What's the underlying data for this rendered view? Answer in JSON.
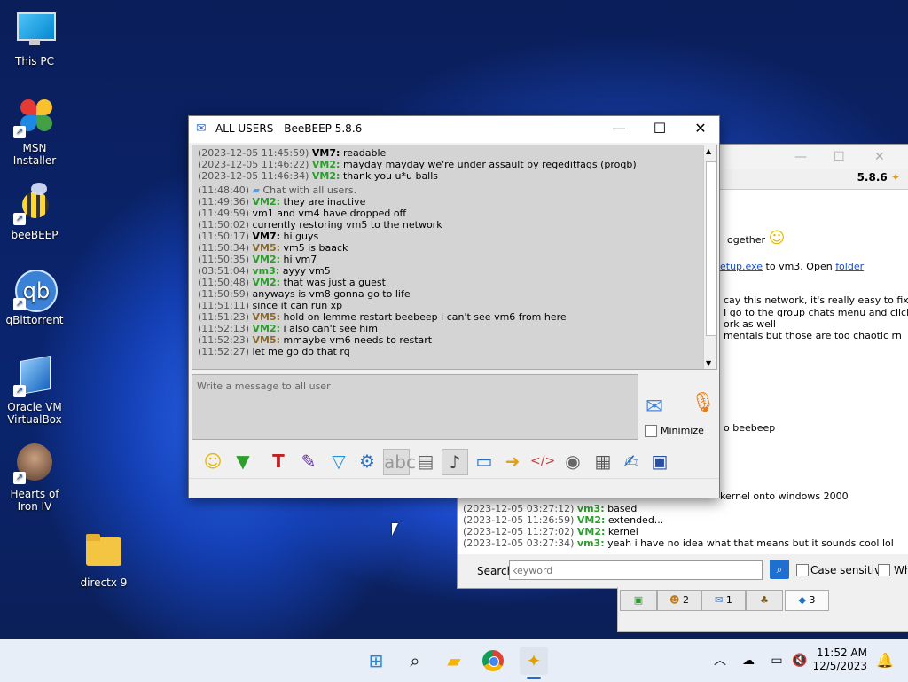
{
  "desktop_icons": [
    {
      "label": "This PC",
      "icon": "monitor-icon"
    },
    {
      "label": "MSN Installer",
      "icon": "msn-butterfly-icon"
    },
    {
      "label": "beeBEEP",
      "icon": "bee-icon"
    },
    {
      "label": "qBittorrent",
      "icon": "qb-icon"
    },
    {
      "label": "Oracle VM VirtualBox",
      "icon": "virtualbox-icon"
    },
    {
      "label": "Hearts of Iron IV",
      "icon": "hoi-icon"
    },
    {
      "label": "directx 9",
      "icon": "folder-icon"
    }
  ],
  "main_window": {
    "title": "ALL USERS - BeeBEEP 5.8.6",
    "messages": [
      {
        "ts": "(2023-12-05 11:45:59)",
        "user": "VM7",
        "cls": "vm7",
        "text": " readable"
      },
      {
        "ts": "(2023-12-05 11:46:22)",
        "user": "VM2",
        "cls": "vm2",
        "text": " mayday mayday we're under assault by regeditfags (proqb)"
      },
      {
        "ts": "(2023-12-05 11:46:34)",
        "user": "VM2",
        "cls": "vm2",
        "text": " thank you u*u balls"
      },
      {
        "ts": "(11:48:40)",
        "user": "",
        "cls": "",
        "text": "Chat with all users.",
        "system": true
      },
      {
        "ts": "(11:49:36)",
        "user": "VM2",
        "cls": "vm2",
        "text": " they are inactive"
      },
      {
        "ts": "(11:49:59)",
        "user": "",
        "cls": "",
        "text": "   vm1 and vm4 have dropped off"
      },
      {
        "ts": "(11:50:02)",
        "user": "",
        "cls": "",
        "text": "   currently restoring vm5 to the network"
      },
      {
        "ts": "(11:50:17)",
        "user": "VM7",
        "cls": "vm7",
        "text": " hi guys"
      },
      {
        "ts": "(11:50:34)",
        "user": "VM5",
        "cls": "vm5",
        "text": " vm5 is baack"
      },
      {
        "ts": "(11:50:35)",
        "user": "VM2",
        "cls": "vm2",
        "text": " hi vm7"
      },
      {
        "ts": "(03:51:04)",
        "user": "vm3",
        "cls": "vm3",
        "text": " ayyy vm5"
      },
      {
        "ts": "(11:50:48)",
        "user": "VM2",
        "cls": "vm2",
        "text": " that was just a guest"
      },
      {
        "ts": "(11:50:59)",
        "user": "",
        "cls": "",
        "text": "   anyways is vm8 gonna go to life"
      },
      {
        "ts": "(11:51:11)",
        "user": "",
        "cls": "",
        "text": "   since it can run xp"
      },
      {
        "ts": "(11:51:23)",
        "user": "VM5",
        "cls": "vm5",
        "text": " hold on lemme restart beebeep i can't see vm6 from here"
      },
      {
        "ts": "(11:52:13)",
        "user": "VM2",
        "cls": "vm2",
        "text": " i also can't see him"
      },
      {
        "ts": "(11:52:23)",
        "user": "VM5",
        "cls": "vm5",
        "text": " mmaybe vm6 needs to restart"
      },
      {
        "ts": "(11:52:27)",
        "user": "",
        "cls": "",
        "text": "   let me go do that rq"
      }
    ],
    "compose_placeholder": "Write a message to all user",
    "minimize_label": "Minimize"
  },
  "bg_window": {
    "version": "5.8.6",
    "snippets": [
      "ogether",
      "etup.exe",
      "to vm3. Open",
      "folder",
      "cay this network, it's really easy to fix thoug",
      "I go to the group chats menu and click all use",
      "ork as well",
      "mentals but those are too chaotic rn",
      "o beebeep",
      "kernel onto windows 2000"
    ],
    "lines": [
      {
        "ts": "(2023-12-05 03:27:12)",
        "user": "vm3:",
        "text": " based"
      },
      {
        "ts": "(2023-12-05 11:26:59)",
        "user": "VM2:",
        "text": " extended..."
      },
      {
        "ts": "(2023-12-05 11:27:02)",
        "user": "VM2:",
        "text": " kernel"
      },
      {
        "ts": "(2023-12-05 03:27:34)",
        "user": "vm3:",
        "text": " yeah i have no idea what that means but it sounds cool lol"
      }
    ],
    "search_label": "Search",
    "search_placeholder": "keyword",
    "case_sensitive": "Case sensitive",
    "whole_label": "Wh",
    "tabs": [
      "",
      "2",
      "1",
      "",
      "3"
    ]
  },
  "taskbar": {
    "time": "11:52 AM",
    "date": "12/5/2023"
  }
}
